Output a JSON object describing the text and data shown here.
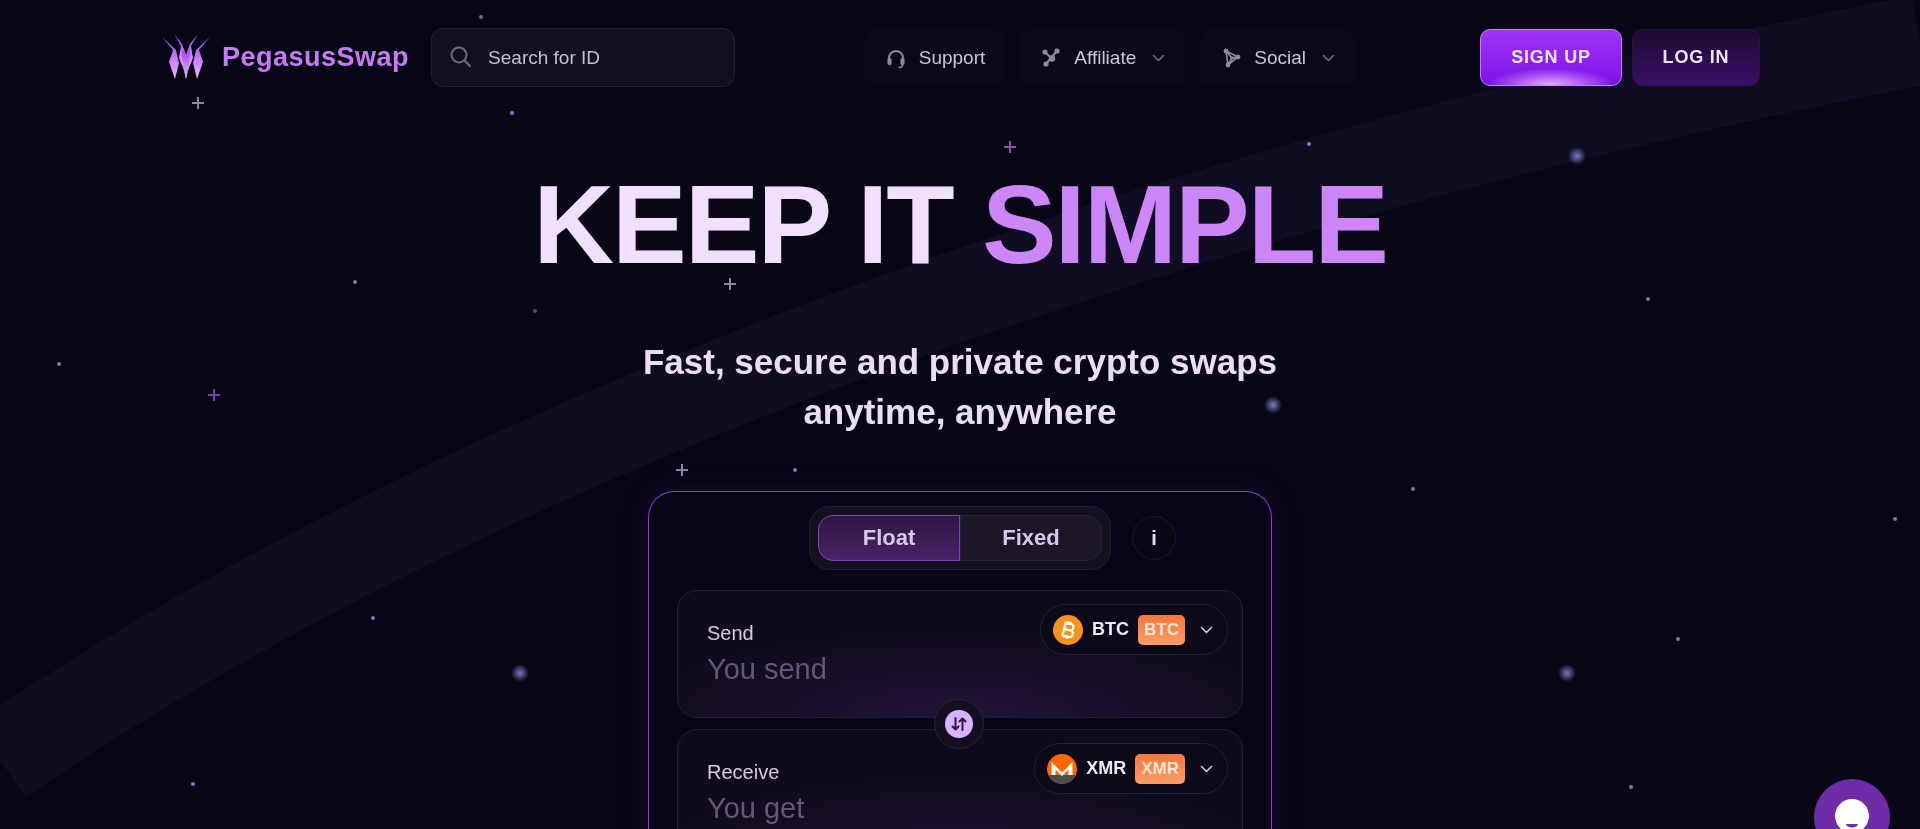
{
  "header": {
    "logo": {
      "text": "PegasusSwap"
    },
    "search": {
      "placeholder": "Search for ID"
    },
    "nav": [
      {
        "label": "Support",
        "dropdown": false
      },
      {
        "label": "Affiliate",
        "dropdown": true
      },
      {
        "label": "Social",
        "dropdown": true
      }
    ],
    "buttons": [
      {
        "label": "SIGN UP",
        "kind": "primary"
      },
      {
        "label": "LOG IN",
        "kind": "secondary"
      }
    ]
  },
  "hero": {
    "title": "KEEP IT",
    "title_accent": "SIMPLE",
    "subtitle": "Fast, secure and private crypto swaps anytime, anywhere"
  },
  "swap": {
    "rate_tabs": [
      {
        "label": "Float",
        "selected": true
      },
      {
        "label": "Fixed",
        "selected": false
      }
    ],
    "info_button": "i",
    "send": {
      "label": "Send",
      "placeholder": "You send",
      "coin": {
        "kind": "bitcoin",
        "symbol": "BTC",
        "badge": "BTC"
      }
    },
    "receive": {
      "label": "Receive",
      "placeholder": "You get",
      "coin": {
        "kind": "monero",
        "symbol": "XMR",
        "badge": "XMR"
      }
    }
  }
}
